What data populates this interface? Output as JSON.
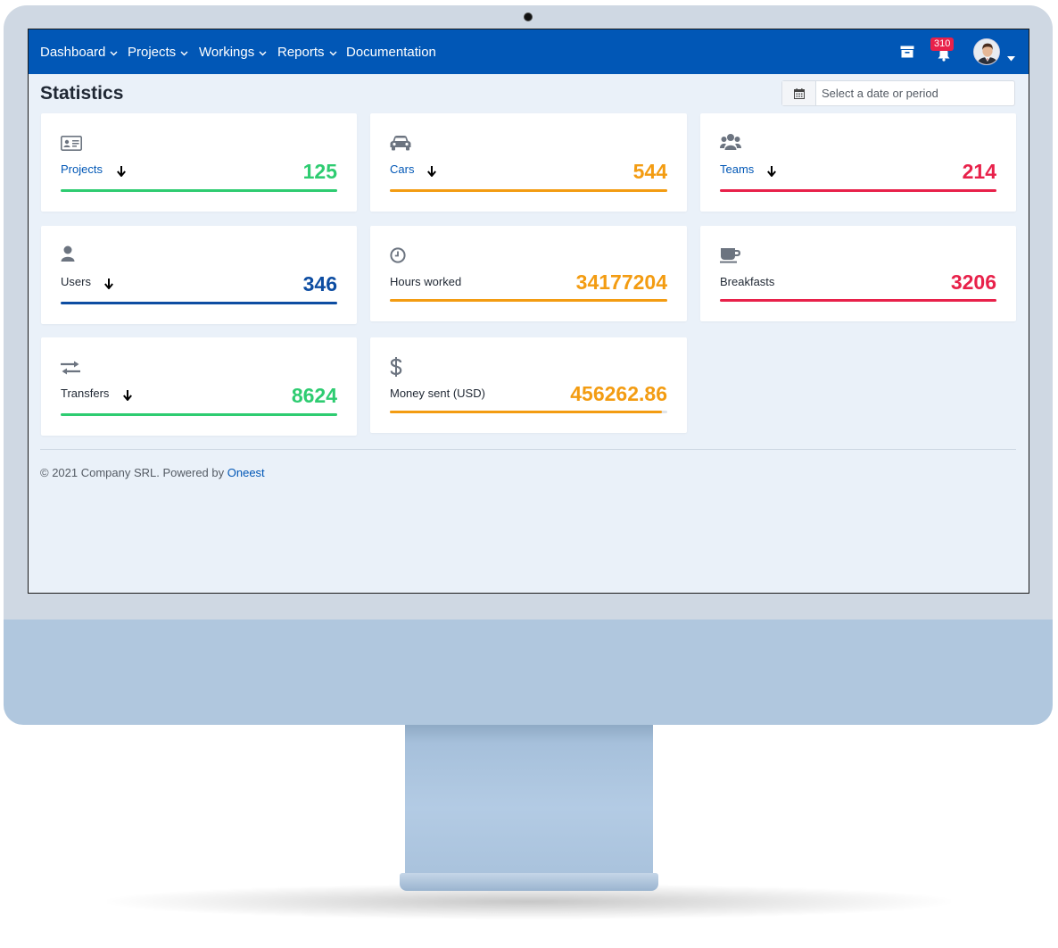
{
  "nav": {
    "items": [
      {
        "label": "Dashboard",
        "has_menu": true
      },
      {
        "label": "Projects",
        "has_menu": true
      },
      {
        "label": "Workings",
        "has_menu": true
      },
      {
        "label": "Reports",
        "has_menu": true
      },
      {
        "label": "Documentation",
        "has_menu": false
      }
    ],
    "notifications_count": "310",
    "right_icons": [
      "archive-icon",
      "bell-icon",
      "avatar",
      "caret-down-icon"
    ]
  },
  "page": {
    "title": "Statistics",
    "date_picker_placeholder": "Select a date or period"
  },
  "stats": [
    {
      "label": "Projects",
      "value": "125",
      "icon": "id-card-icon",
      "color": "#2ecc71",
      "link": true,
      "sortable": true,
      "progress": 1.0
    },
    {
      "label": "Cars",
      "value": "544",
      "icon": "car-icon",
      "color": "#f39c12",
      "link": true,
      "sortable": true,
      "progress": 1.0
    },
    {
      "label": "Teams",
      "value": "214",
      "icon": "users-icon",
      "color": "#e8214a",
      "link": true,
      "sortable": true,
      "progress": 1.0
    },
    {
      "label": "Users",
      "value": "346",
      "icon": "user-icon",
      "color": "#0d4da2",
      "link": false,
      "sortable": true,
      "progress": 1.0
    },
    {
      "label": "Hours worked",
      "value": "34177204",
      "icon": "clock-icon",
      "color": "#f39c12",
      "link": false,
      "sortable": false,
      "progress": 1.0
    },
    {
      "label": "Breakfasts",
      "value": "3206",
      "icon": "coffee-icon",
      "color": "#e8214a",
      "link": false,
      "sortable": false,
      "progress": 1.0
    },
    {
      "label": "Transfers",
      "value": "8624",
      "icon": "exchange-icon",
      "color": "#2ecc71",
      "link": false,
      "sortable": true,
      "progress": 1.0
    },
    {
      "label": "Money sent (USD)",
      "value": "456262.86",
      "icon": "dollar-icon",
      "color": "#f39c12",
      "link": false,
      "sortable": false,
      "progress": 0.98
    }
  ],
  "footer": {
    "text": "© 2021 Company SRL. Powered by ",
    "link": "Oneest"
  }
}
